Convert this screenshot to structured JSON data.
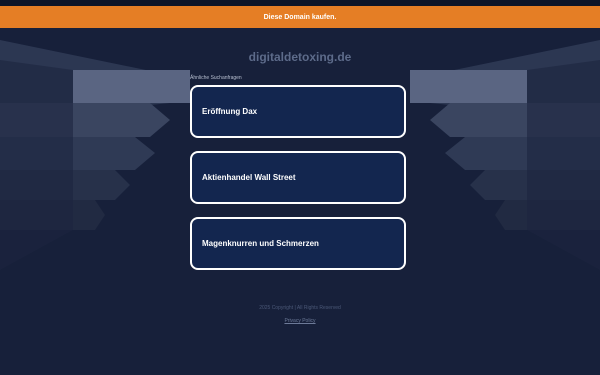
{
  "banner": {
    "text": "Diese Domain kaufen."
  },
  "domain": {
    "name": "digitaldetoxing.de"
  },
  "related": {
    "label": "Ähnliche Suchanfragen",
    "links": [
      {
        "text": "Eröffnung Dax"
      },
      {
        "text": "Aktienhandel Wall Street"
      },
      {
        "text": "Magenknurren und Schmerzen"
      }
    ]
  },
  "footer": {
    "copyright": "2025 Copyright | All Rights Reserved",
    "privacy": "Privacy Policy"
  },
  "colors": {
    "background": "#17203a",
    "banner": "#e57e25",
    "link_box": "#13264f"
  }
}
